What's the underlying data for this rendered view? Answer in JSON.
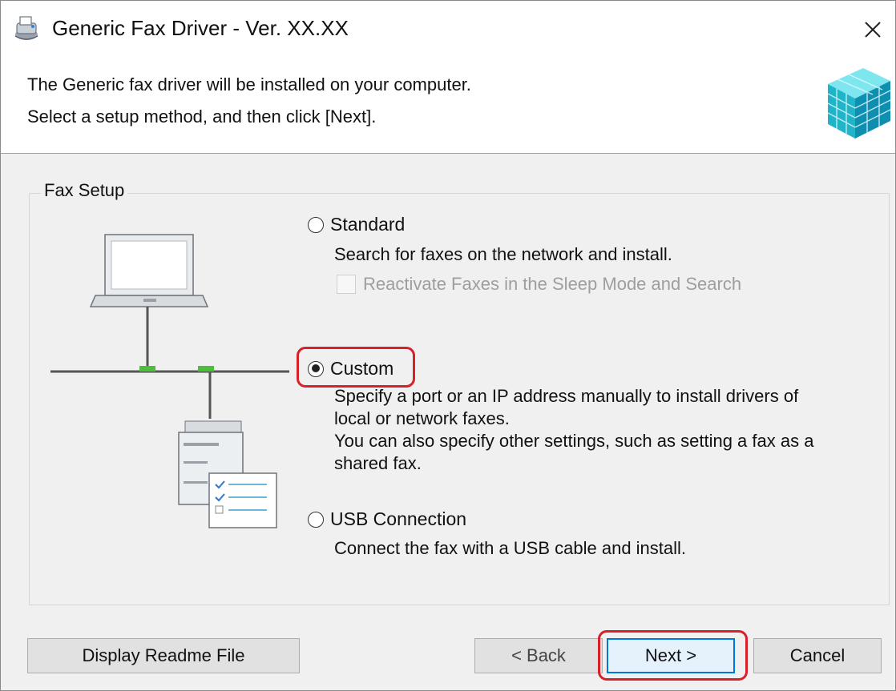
{
  "window": {
    "title": "Generic Fax Driver - Ver. XX.XX",
    "icon": "fax-driver-app-icon",
    "close_icon": "close-icon"
  },
  "header": {
    "line1": "The Generic fax driver will be installed on your computer.",
    "line2": "Select a setup method, and then click [Next].",
    "icon": "installer-cube-icon"
  },
  "fax_setup": {
    "group_label": "Fax Setup",
    "options": [
      {
        "label": "Standard",
        "selected": false,
        "description": [
          "Search for faxes on the network and install."
        ],
        "checkbox": {
          "label": "Reactivate Faxes in the Sleep Mode and Search",
          "checked": false,
          "enabled": false
        }
      },
      {
        "label": "Custom",
        "selected": true,
        "highlighted": true,
        "description": [
          "Specify a port or an IP address manually to install drivers of",
          "local or network faxes.",
          "You can also specify other settings, such as setting a fax as a",
          "shared fax."
        ]
      },
      {
        "label": "USB Connection",
        "selected": false,
        "description": [
          "Connect the fax with a USB cable and install."
        ]
      }
    ],
    "illustration_icons": [
      "laptop-icon",
      "network-line-icon",
      "fax-machine-icon",
      "checklist-icon"
    ]
  },
  "buttons": {
    "readme": "Display Readme File",
    "back": "< Back",
    "next": "Next >",
    "cancel": "Cancel",
    "next_highlighted": true
  },
  "colors": {
    "highlight": "#d8202a",
    "default_button_border": "#0078d7",
    "window_bg": "#f0f0f0"
  }
}
